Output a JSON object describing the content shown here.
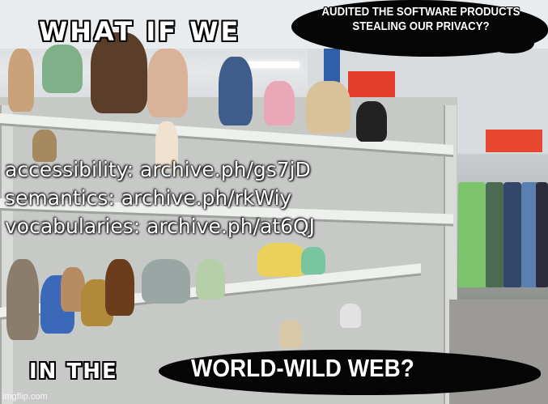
{
  "meme": {
    "top_caption": "WHAT IF WE",
    "top_right_caption": [
      "AUDITED THE SOFTWARE PRODUCTS",
      "STEALING OUR PRIVACY?"
    ],
    "overlay_lines": [
      "accessibility: archive.ph/gs7jD",
      "semantics: archive.ph/rkWiy",
      "vocabularies: archive.ph/at6QJ"
    ],
    "bottom_caption": "IN THE",
    "bottom_replacement": "WORLD-WILD WEB?",
    "watermark": "imgflip.com"
  }
}
